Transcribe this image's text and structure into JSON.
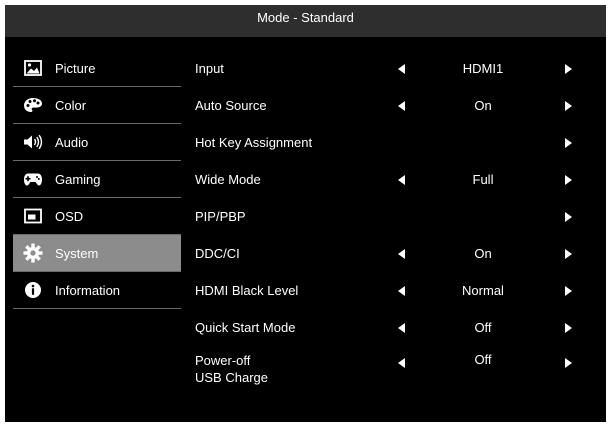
{
  "title": "Mode - Standard",
  "sidebar": {
    "items": [
      {
        "label": "Picture",
        "icon": "picture-icon",
        "active": false
      },
      {
        "label": "Color",
        "icon": "palette-icon",
        "active": false
      },
      {
        "label": "Audio",
        "icon": "speaker-icon",
        "active": false
      },
      {
        "label": "Gaming",
        "icon": "gamepad-icon",
        "active": false
      },
      {
        "label": "OSD",
        "icon": "osd-icon",
        "active": false
      },
      {
        "label": "System",
        "icon": "gear-icon",
        "active": true
      },
      {
        "label": "Information",
        "icon": "info-icon",
        "active": false
      }
    ]
  },
  "settings": {
    "rows": [
      {
        "label": "Input",
        "value": "HDMI1"
      },
      {
        "label": "Auto Source",
        "value": "On"
      },
      {
        "label": "Hot Key Assignment",
        "value": ""
      },
      {
        "label": "Wide Mode",
        "value": "Full"
      },
      {
        "label": "PIP/PBP",
        "value": ""
      },
      {
        "label": "DDC/CI",
        "value": "On"
      },
      {
        "label": "HDMI Black Level",
        "value": "Normal"
      },
      {
        "label": "Quick Start Mode",
        "value": "Off"
      },
      {
        "label": "Power-off",
        "label2": "USB Charge",
        "value": "Off"
      }
    ]
  },
  "colors": {
    "background": "#000000",
    "title_bar": "#2e2e2e",
    "active_item": "#8c8c8c",
    "text": "#ffffff"
  }
}
